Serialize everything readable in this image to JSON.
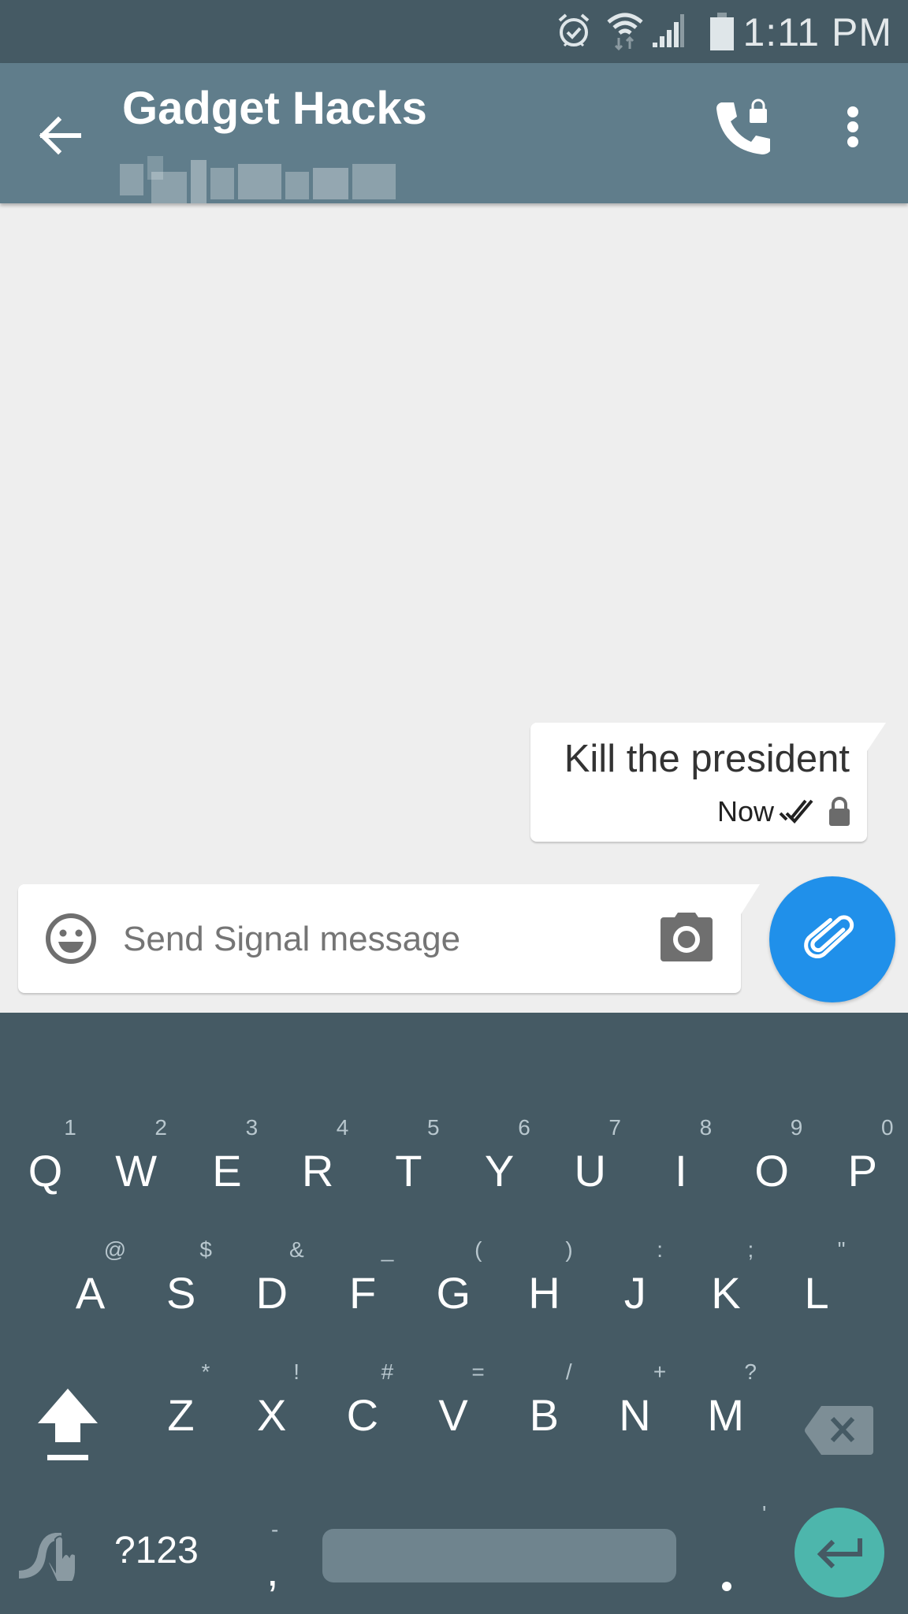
{
  "status_bar": {
    "time": "1:11 PM",
    "icons": [
      "alarm-icon",
      "wifi-icon",
      "signal-icon",
      "battery-icon"
    ]
  },
  "toolbar": {
    "title": "Gadget Hacks",
    "subtitle": "",
    "back_icon": "arrow-left-icon",
    "call_icon": "secure-call-icon",
    "menu_icon": "more-vert-icon",
    "color": "#607d8b"
  },
  "messages": [
    {
      "text": "Kill the president",
      "time": "Now",
      "status": "delivered",
      "secure": true,
      "direction": "outgoing"
    }
  ],
  "compose": {
    "placeholder": "Send Signal message",
    "value": "",
    "emoji_icon": "emoji-icon",
    "camera_icon": "camera-icon",
    "attach_icon": "paperclip-icon",
    "attach_color": "#2090ea"
  },
  "keyboard": {
    "row1": [
      {
        "letter": "Q",
        "hint": "1"
      },
      {
        "letter": "W",
        "hint": "2"
      },
      {
        "letter": "E",
        "hint": "3"
      },
      {
        "letter": "R",
        "hint": "4"
      },
      {
        "letter": "T",
        "hint": "5"
      },
      {
        "letter": "Y",
        "hint": "6"
      },
      {
        "letter": "U",
        "hint": "7"
      },
      {
        "letter": "I",
        "hint": "8"
      },
      {
        "letter": "O",
        "hint": "9"
      },
      {
        "letter": "P",
        "hint": "0"
      }
    ],
    "row2": [
      {
        "letter": "A",
        "hint": "@"
      },
      {
        "letter": "S",
        "hint": "$"
      },
      {
        "letter": "D",
        "hint": "&"
      },
      {
        "letter": "F",
        "hint": "_"
      },
      {
        "letter": "G",
        "hint": "("
      },
      {
        "letter": "H",
        "hint": ")"
      },
      {
        "letter": "J",
        "hint": ":"
      },
      {
        "letter": "K",
        "hint": ";"
      },
      {
        "letter": "L",
        "hint": "\""
      }
    ],
    "row3": [
      {
        "letter": "Z",
        "hint": "*"
      },
      {
        "letter": "X",
        "hint": "!"
      },
      {
        "letter": "C",
        "hint": "#"
      },
      {
        "letter": "V",
        "hint": "="
      },
      {
        "letter": "B",
        "hint": "/"
      },
      {
        "letter": "N",
        "hint": "+"
      },
      {
        "letter": "M",
        "hint": "?"
      }
    ],
    "symbols_label": "?123",
    "comma": {
      "letter": ",",
      "hint": "-"
    },
    "period": {
      "letter": ".",
      "hint": "'"
    },
    "enter_color": "#4db6ac"
  }
}
